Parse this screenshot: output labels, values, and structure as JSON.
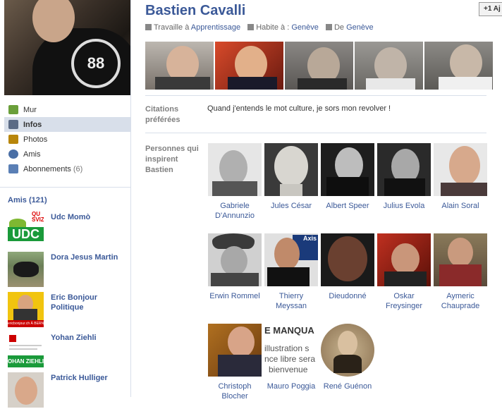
{
  "profile": {
    "name": "Bastien Cavalli",
    "add_button": "+1 Aj",
    "emblem": "88",
    "meta": {
      "work_prefix": "Travaille à",
      "work_value": "Apprentissage",
      "lives_prefix": "Habite à :",
      "lives_value": "Genève",
      "from_prefix": "De",
      "from_value": "Genève"
    }
  },
  "nav": {
    "items": [
      {
        "label": "Mur",
        "icon": "wall-icon",
        "color": "#6a9f3a"
      },
      {
        "label": "Infos",
        "icon": "info-icon",
        "color": "#5b6b85"
      },
      {
        "label": "Photos",
        "icon": "photos-icon",
        "color": "#b8860b"
      },
      {
        "label": "Amis",
        "icon": "friends-icon",
        "color": "#4a6fa5"
      },
      {
        "label": "Abonnements",
        "icon": "rss-icon",
        "color": "#5a7fb5",
        "count": "(6)"
      }
    ]
  },
  "friends": {
    "title": "Amis (121)",
    "items": [
      {
        "name": "Udc Momò"
      },
      {
        "name": "Dora Jesus Martin"
      },
      {
        "name": "Eric Bonjour Politique"
      },
      {
        "name": "Yohan Ziehli"
      },
      {
        "name": "Patrick Hulliger"
      }
    ]
  },
  "sections": {
    "quotes_label": "Citations préférées",
    "quote_text": "Quand j'entends le mot culture, je sors mon revolver !",
    "inspire_label": "Personnes qui inspirent Bastien"
  },
  "inspirations": [
    {
      "name": "Gabriele D'Annunzio"
    },
    {
      "name": "Jules César"
    },
    {
      "name": "Albert Speer"
    },
    {
      "name": "Julius Evola"
    },
    {
      "name": "Alain Soral"
    },
    {
      "name": "Erwin Rommel"
    },
    {
      "name": "Thierry Meyssan"
    },
    {
      "name": "Dieudonné"
    },
    {
      "name": "Oskar Freysinger"
    },
    {
      "name": "Aymeric Chauprade"
    },
    {
      "name": "Christoph Blocher"
    },
    {
      "name": "Mauro Poggia"
    },
    {
      "name": "René Guénon"
    }
  ],
  "image_text": {
    "udc_top": "QU SVIZ",
    "udc_logo": "UDC",
    "bonjour_banner": "ericbonjour.ch À BERNE",
    "ziehli_banner": "OHAN ZIEHLI",
    "poggia_lines": [
      "E MANQUA",
      "illustration s",
      "nce libre sera",
      "bienvenue"
    ],
    "meyssan_badge": "Axis"
  }
}
